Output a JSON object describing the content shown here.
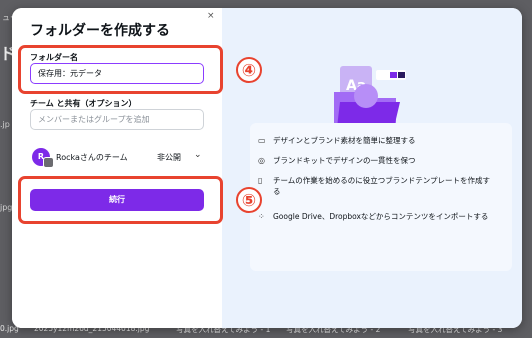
{
  "background": {
    "top_fragment": "ュー",
    "side_glyph": "ド",
    "left_fragment_1": ".jp",
    "left_fragment_2": "jpg",
    "bottom_items": [
      "0.jpg",
      "2025y12m26d_215044018.jpg",
      "写真を入れ替えてみよう - 1",
      "写真を入れ替えてみよう - 2",
      "写真を入れ替えてみよう - 3"
    ]
  },
  "modal": {
    "title": "フォルダーを作成する",
    "close_label": "×",
    "folder_name_label": "フォルダー名",
    "folder_name_value": "保存用：元データ",
    "share_label": "チーム と共有（オプション）",
    "share_placeholder": "メンバーまたはグループを追加",
    "team": {
      "avatar_letter": "R",
      "name": "Rockaさんのチーム",
      "privacy": "非公開",
      "chevron": "⌄"
    },
    "continue_label": "続行"
  },
  "annotations": {
    "step4": "④",
    "step5": "⑤",
    "color": "#e8432f"
  },
  "features": [
    {
      "icon": "folder-icon",
      "text": "デザインとブランド素材を簡単に整理する"
    },
    {
      "icon": "brand-kit-icon",
      "text": "ブランドキットでデザインの一貫性を保つ"
    },
    {
      "icon": "template-icon",
      "text": "チームの作業を始めるのに役立つブランドテンプレートを作成する"
    },
    {
      "icon": "import-grid-icon",
      "text": "Google Drive、Dropboxなどからコンテンツをインポートする"
    }
  ],
  "colors": {
    "brand_purple": "#7d2ae8",
    "panel_blue": "#eaf2fd"
  }
}
